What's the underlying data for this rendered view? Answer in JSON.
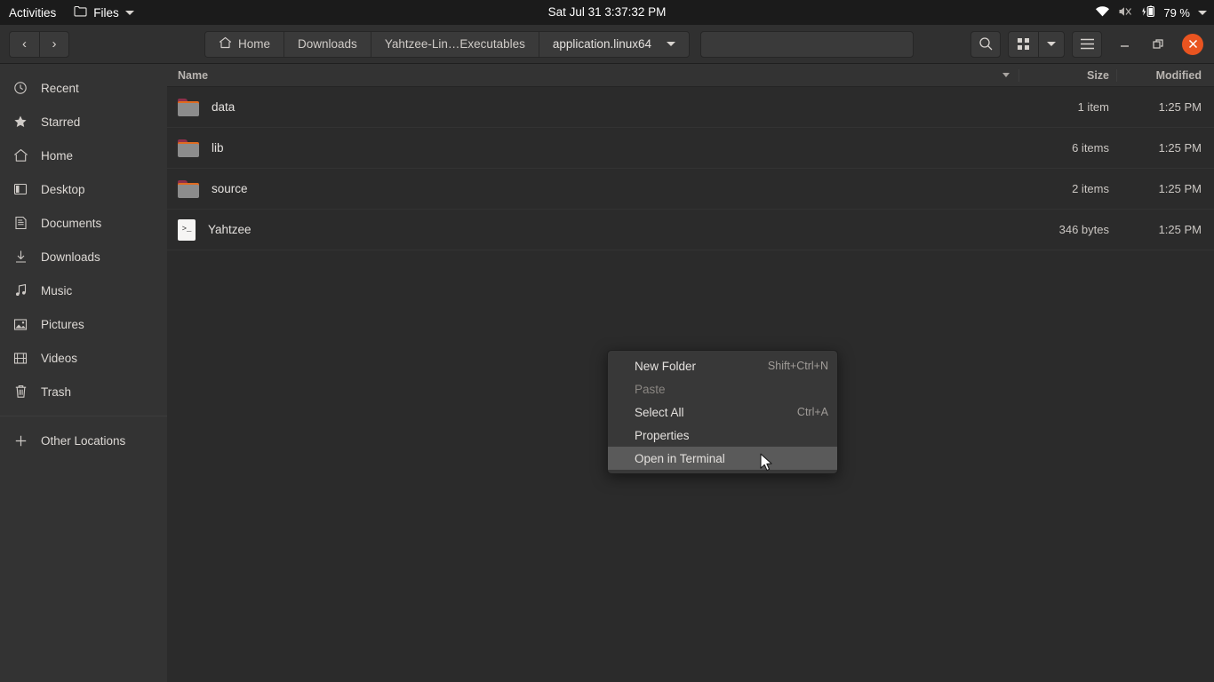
{
  "topbar": {
    "activities": "Activities",
    "app_name": "Files",
    "clock": "Sat Jul 31  3:37:32 PM",
    "battery_percent": "79 %",
    "icons": [
      "folder-icon",
      "chevron-down-icon",
      "wifi-icon",
      "speaker-muted-icon",
      "battery-charging-icon",
      "chevron-down-icon"
    ]
  },
  "headerbar": {
    "back_glyph": "‹",
    "forward_glyph": "›",
    "breadcrumbs": [
      {
        "label": "Home",
        "icon": "home-icon"
      },
      {
        "label": "Downloads",
        "icon": ""
      },
      {
        "label": "Yahtzee-Lin…Executables",
        "icon": ""
      },
      {
        "label": "application.linux64",
        "icon": ""
      }
    ],
    "path_dropdown_glyph": "▾",
    "search_label": "search-icon",
    "grid_view_label": "grid-view-icon",
    "view_dropdown_glyph": "▾",
    "menu_label": "hamburger-menu-icon",
    "minimize_glyph": "—",
    "maximize_glyph": "❐",
    "close_glyph": "✕",
    "close_color": "#e95420"
  },
  "sidebar": {
    "items": [
      {
        "label": "Recent",
        "icon": "clock-icon"
      },
      {
        "label": "Starred",
        "icon": "star-icon"
      },
      {
        "label": "Home",
        "icon": "home-icon"
      },
      {
        "label": "Desktop",
        "icon": "desktop-icon"
      },
      {
        "label": "Documents",
        "icon": "document-icon"
      },
      {
        "label": "Downloads",
        "icon": "download-icon"
      },
      {
        "label": "Music",
        "icon": "music-note-icon"
      },
      {
        "label": "Pictures",
        "icon": "picture-icon"
      },
      {
        "label": "Videos",
        "icon": "video-film-icon"
      },
      {
        "label": "Trash",
        "icon": "trash-icon"
      }
    ],
    "other_locations": {
      "label": "Other Locations",
      "icon": "plus-icon"
    }
  },
  "filelist": {
    "columns": {
      "name": "Name",
      "size": "Size",
      "modified": "Modified"
    },
    "rows": [
      {
        "name": "data",
        "icon": "folder-icon",
        "size": "1 item",
        "modified": "1:25 PM"
      },
      {
        "name": "lib",
        "icon": "folder-icon",
        "size": "6 items",
        "modified": "1:25 PM"
      },
      {
        "name": "source",
        "icon": "folder-icon",
        "size": "2 items",
        "modified": "1:25 PM"
      },
      {
        "name": "Yahtzee",
        "icon": "script-icon",
        "size": "346 bytes",
        "modified": "1:25 PM"
      }
    ],
    "script_icon_glyph": ">_"
  },
  "context_menu": {
    "items": [
      {
        "label": "New Folder",
        "accel": "Shift+Ctrl+N",
        "state": "normal"
      },
      {
        "label": "Paste",
        "accel": "",
        "state": "disabled"
      },
      {
        "label": "Select All",
        "accel": "Ctrl+A",
        "state": "normal"
      },
      {
        "label": "Properties",
        "accel": "",
        "state": "normal"
      },
      {
        "label": "Open in Terminal",
        "accel": "",
        "state": "highlight"
      }
    ]
  }
}
